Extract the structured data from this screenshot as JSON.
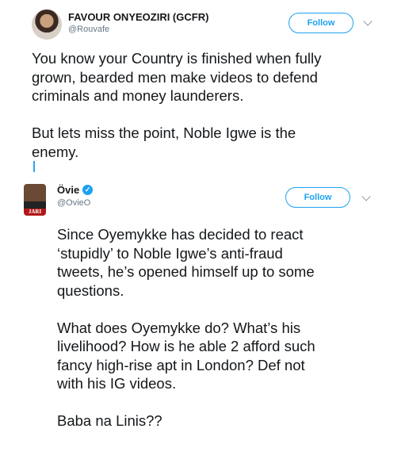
{
  "tweet1": {
    "name": "FAVOUR ONYEOZIRI (GCFR)",
    "handle": "@Rouvafe",
    "follow_label": "Follow",
    "text": "You know your Country is finished when fully\ngrown, bearded men make videos to defend\ncriminals and money launderers.\n\nBut lets miss the point, Noble Igwe is the\nenemy."
  },
  "tweet2": {
    "name": "Övie",
    "handle": "@OvieO",
    "follow_label": "Follow",
    "avatar_tag": "JARI",
    "verified_icon": "✓",
    "text": "Since Oyemykke has decided to react\n‘stupidly’ to Noble Igwe’s anti-fraud\ntweets, he’s opened himself up to some\nquestions.\n\nWhat does Oyemykke do? What’s his\nlivelihood? How is he able 2 afford such\nfancy high-rise apt in London? Def not\nwith his IG videos.\n\nBaba na Linis??"
  },
  "colors": {
    "accent": "#1da1f2",
    "text": "#14171a",
    "muted": "#657786"
  }
}
